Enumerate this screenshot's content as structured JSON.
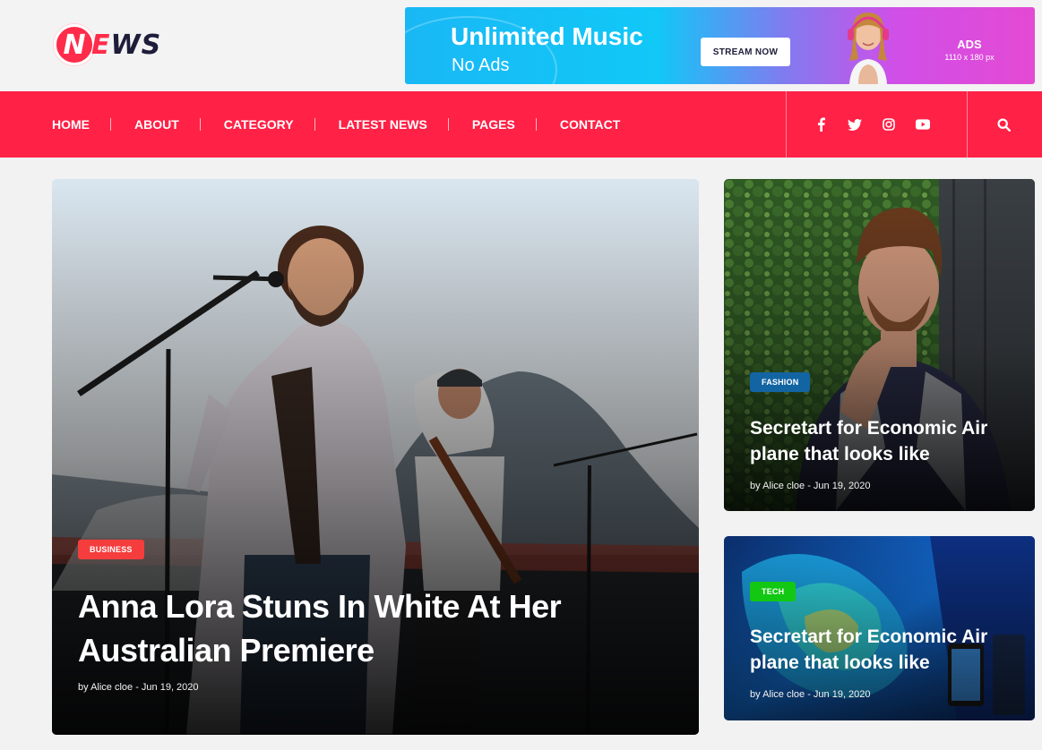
{
  "logo": {
    "letter": "N",
    "e": "E",
    "rest": "WS"
  },
  "ad": {
    "title": "Unlimited Music",
    "subtitle": "No Ads",
    "button": "STREAM NOW",
    "label": "ADS",
    "size": "1110 x 180 px"
  },
  "nav": {
    "items": [
      "HOME",
      "ABOUT",
      "CATEGORY",
      "LATEST NEWS",
      "PAGES",
      "CONTACT"
    ],
    "social": [
      "facebook-icon",
      "twitter-icon",
      "instagram-icon",
      "youtube-icon"
    ],
    "search": "search-icon"
  },
  "colors": {
    "accent": "#ff2146",
    "business": "#f53d3d",
    "fashion": "#1264a3",
    "tech": "#12c812"
  },
  "hero": {
    "tag": "BUSINESS",
    "title": "Anna Lora Stuns In White At Her Australian Premiere",
    "meta": "by Alice cloe - Jun 19, 2020"
  },
  "side_posts": [
    {
      "tag": "FASHION",
      "title": "Secretart for Economic Air plane that looks like",
      "meta": "by Alice cloe - Jun 19, 2020"
    },
    {
      "tag": "TECH",
      "title": "Secretart for Economic Air plane that looks like",
      "meta": "by Alice cloe - Jun 19, 2020"
    }
  ]
}
